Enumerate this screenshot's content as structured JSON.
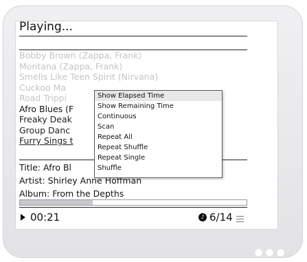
{
  "header": {
    "title": "Playing..."
  },
  "playlist": {
    "items": [
      "Bobby Brown (Zappa, Frank)",
      "Montana (Zappa, Frank)",
      "Smells Like Teen Spirit (Nirvana)",
      "Cuckoo Ma",
      "Road Trippi",
      "Afro Blues (F",
      "Freaky Deak",
      "Group Danc",
      "Furry Sings t"
    ]
  },
  "context_menu": {
    "items": [
      "Show Elapsed Time",
      "Show Remaining Time",
      "Continuous",
      "Scan",
      "Repeat All",
      "Repeat Shuffle",
      "Repeat Single",
      "Shuffle"
    ],
    "selected_index": 0
  },
  "now_playing": {
    "title": "Title: Afro Bl",
    "artist": "Artist: Shirley Anne Hoffman",
    "album": "Album: From the Depths"
  },
  "status": {
    "elapsed": "00:21",
    "track_position": "6/14",
    "progress_fraction": 0.32,
    "play_state_icon": "play-icon",
    "track_badge_icon": "track-number-icon",
    "list_icon": "playlist-icon"
  }
}
